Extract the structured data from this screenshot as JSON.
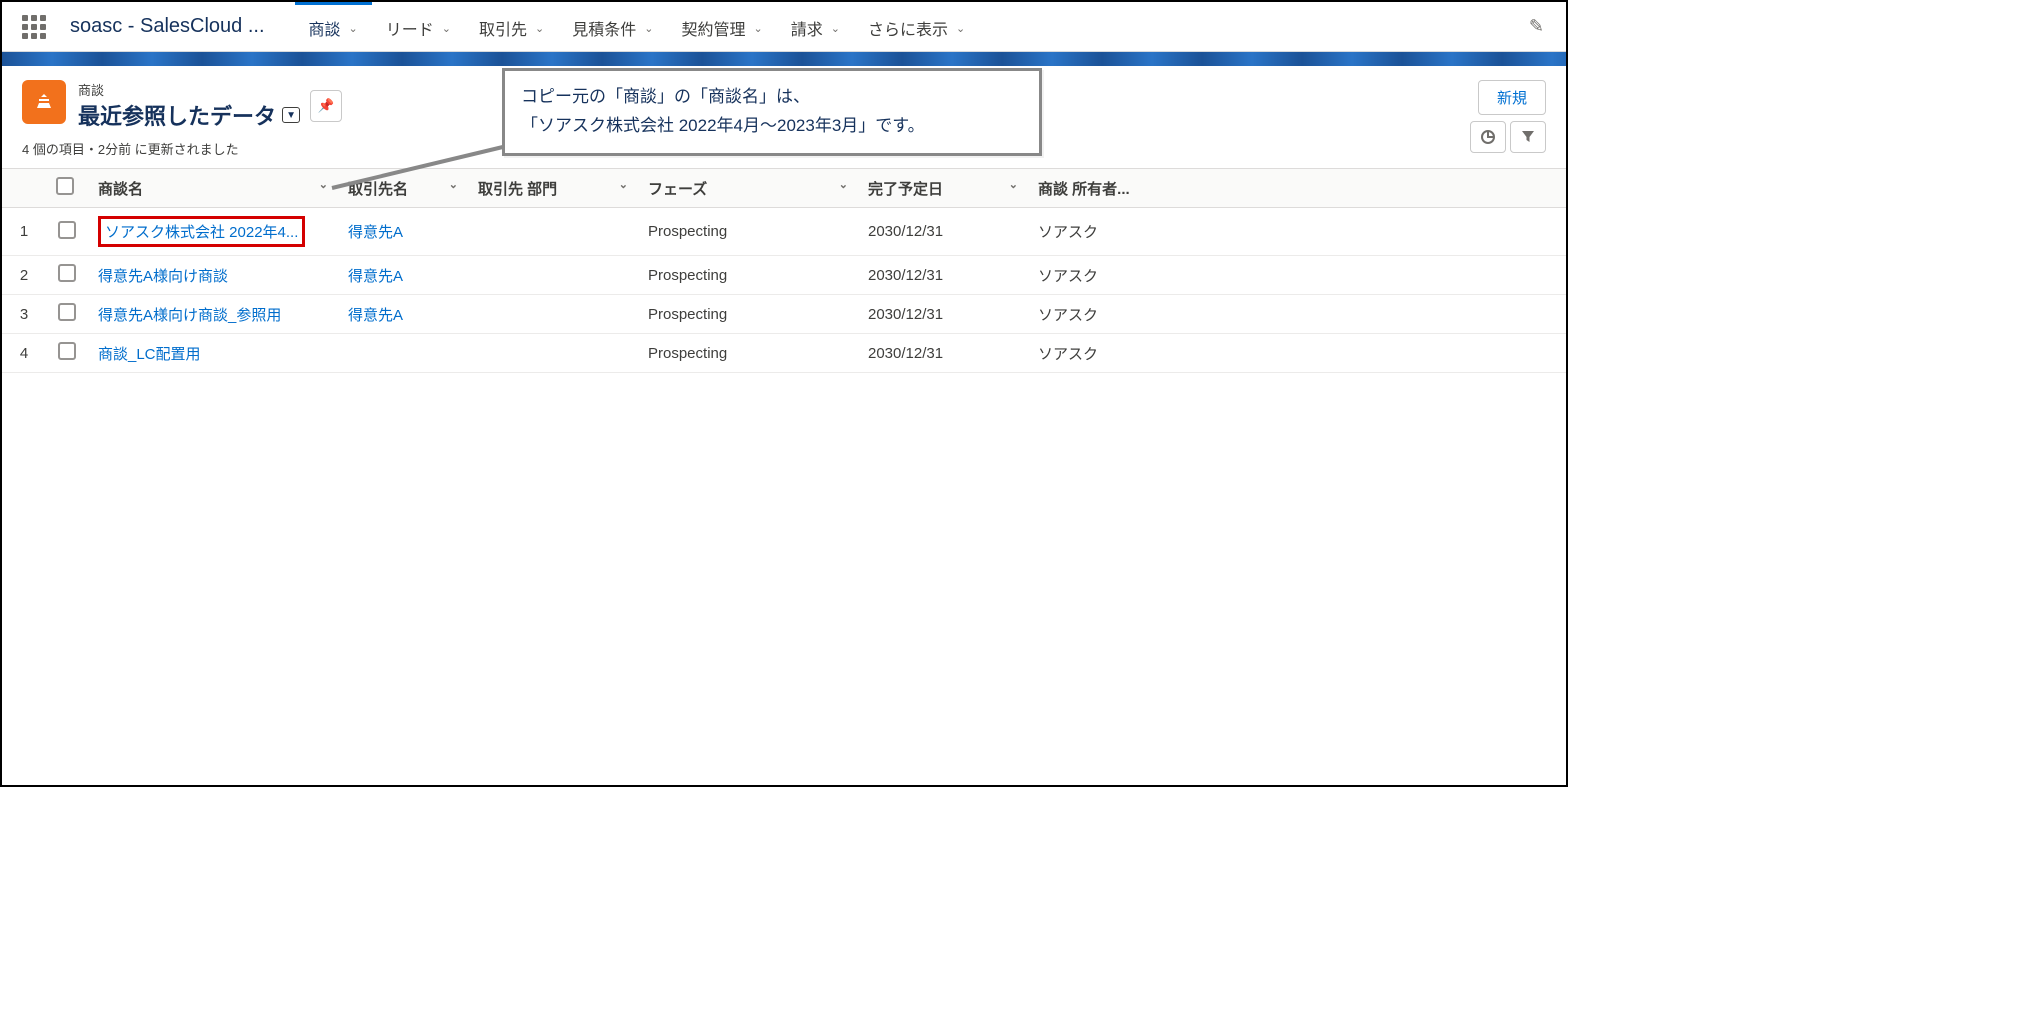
{
  "app_name": "soasc - SalesCloud ...",
  "nav": {
    "tabs": [
      {
        "label": "商談",
        "active": true
      },
      {
        "label": "リード"
      },
      {
        "label": "取引先"
      },
      {
        "label": "見積条件"
      },
      {
        "label": "契約管理"
      },
      {
        "label": "請求"
      },
      {
        "label": "さらに表示"
      }
    ]
  },
  "object_label": "商談",
  "list_view_name": "最近参照したデータ",
  "meta_text": "4 個の項目・2分前 に更新されました",
  "new_button": "新規",
  "callout": {
    "line1": "コピー元の「商談」の「商談名」は、",
    "line2": "「ソアスク株式会社 2022年4月～2023年3月」です。"
  },
  "columns": {
    "name": "商談名",
    "account": "取引先名",
    "dept": "取引先 部門",
    "phase": "フェーズ",
    "close_date": "完了予定日",
    "owner": "商談 所有者..."
  },
  "rows": [
    {
      "num": "1",
      "name": "ソアスク株式会社 2022年4...",
      "account": "得意先A",
      "dept": "",
      "phase": "Prospecting",
      "close_date": "2030/12/31",
      "owner": "ソアスク",
      "highlight": true
    },
    {
      "num": "2",
      "name": "得意先A様向け商談",
      "account": "得意先A",
      "dept": "",
      "phase": "Prospecting",
      "close_date": "2030/12/31",
      "owner": "ソアスク"
    },
    {
      "num": "3",
      "name": "得意先A様向け商談_参照用",
      "account": "得意先A",
      "dept": "",
      "phase": "Prospecting",
      "close_date": "2030/12/31",
      "owner": "ソアスク"
    },
    {
      "num": "4",
      "name": "商談_LC配置用",
      "account": "",
      "dept": "",
      "phase": "Prospecting",
      "close_date": "2030/12/31",
      "owner": "ソアスク"
    }
  ]
}
